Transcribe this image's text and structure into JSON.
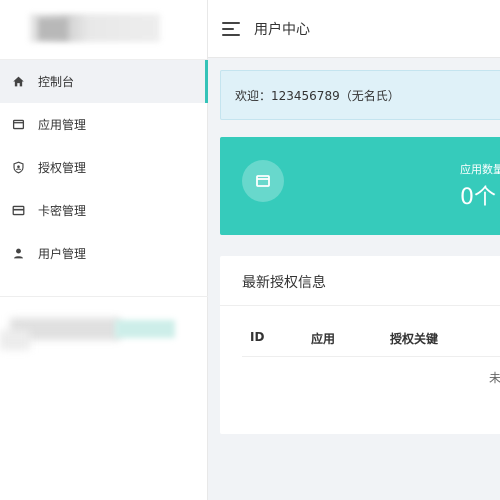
{
  "header": {
    "title": "用户中心"
  },
  "sidebar": {
    "items": [
      {
        "label": "控制台",
        "icon": "home-icon",
        "active": true
      },
      {
        "label": "应用管理",
        "icon": "window-icon",
        "active": false
      },
      {
        "label": "授权管理",
        "icon": "shield-icon",
        "active": false
      },
      {
        "label": "卡密管理",
        "icon": "card-icon",
        "active": false
      },
      {
        "label": "用户管理",
        "icon": "user-icon",
        "active": false
      }
    ]
  },
  "welcome": {
    "text": "欢迎：123456789（无名氏）"
  },
  "stat": {
    "label": "应用数量",
    "value": "0个",
    "icon": "window-icon",
    "color": "#36cbbb"
  },
  "panel": {
    "title": "最新授权信息",
    "columns": [
      "ID",
      "应用",
      "授权关键"
    ],
    "empty_text": "未"
  },
  "colors": {
    "accent": "#34c3b8",
    "welcome_bg": "#dff1f8"
  }
}
